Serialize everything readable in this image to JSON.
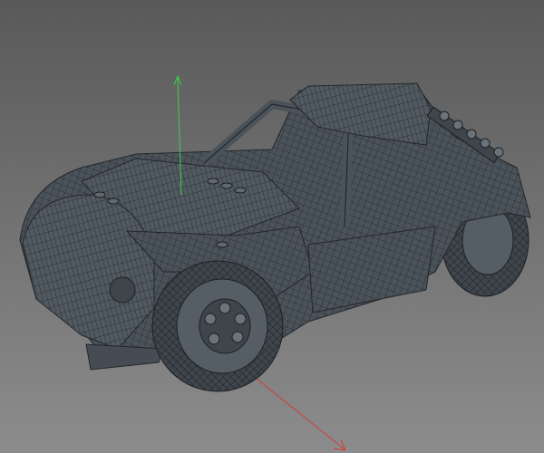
{
  "viewport": {
    "background_top": "#595959",
    "background_bottom": "#8c8c8c",
    "model": {
      "fill": "#4b535a",
      "wire": "#23272b",
      "highlight": "#6a737a"
    },
    "gizmo": {
      "y_axis_color": "#3fd14a",
      "x_axis_color": "#d23a3a",
      "icons": [
        "y-axis-arrow-icon",
        "x-axis-arrow-icon"
      ]
    }
  }
}
